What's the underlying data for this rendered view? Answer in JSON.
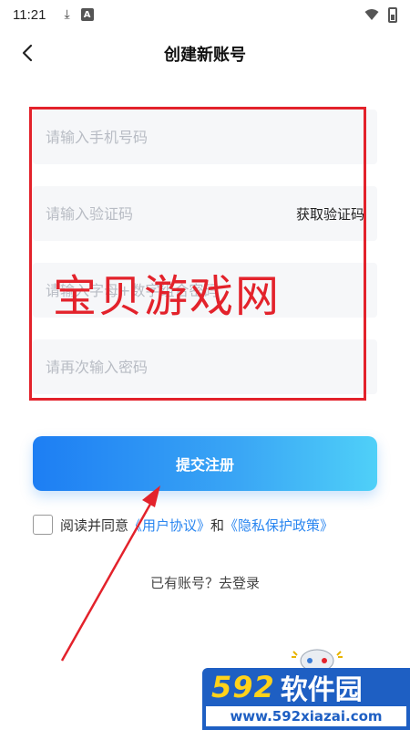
{
  "status_bar": {
    "time": "11:21",
    "download_icon": "download-icon",
    "app_badge": "A"
  },
  "nav": {
    "back_icon": "chevron-left-icon",
    "title": "创建新账号"
  },
  "form": {
    "phone_placeholder": "请输入手机号码",
    "code_placeholder": "请输入验证码",
    "get_code_label": "获取验证码",
    "password_placeholder": "请输入字母+数字组合密码",
    "confirm_placeholder": "请再次输入密码"
  },
  "watermark": "宝贝游戏网",
  "submit_label": "提交注册",
  "agreement": {
    "prefix": "阅读并同意",
    "user_agreement": "《用户协议》",
    "and": "和",
    "privacy_policy": "《隐私保护政策》"
  },
  "login_link": "已有账号？去登录",
  "brand": {
    "number": "592",
    "name": "软件园",
    "url": "www.592xiazai.com"
  },
  "colors": {
    "accent": "#2a86f0",
    "annotation_red": "#e3222b",
    "brand_blue": "#1e5fc3"
  }
}
